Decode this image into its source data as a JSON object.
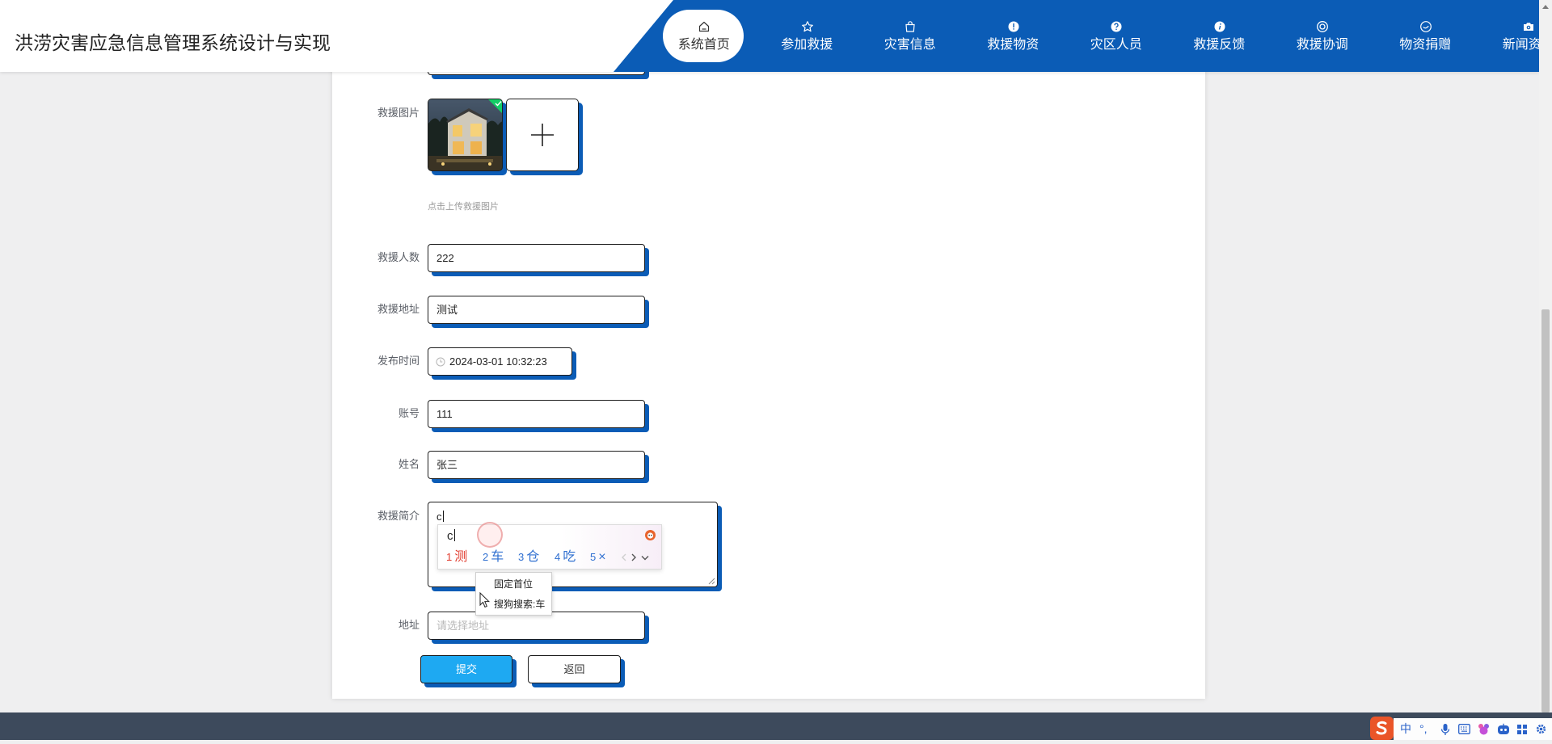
{
  "header": {
    "title": "洪涝灾害应急信息管理系统设计与实现"
  },
  "nav": {
    "items": [
      {
        "label": "系统首页",
        "icon": "home-icon",
        "active": true
      },
      {
        "label": "参加救援",
        "icon": "star-icon"
      },
      {
        "label": "灾害信息",
        "icon": "bag-icon"
      },
      {
        "label": "救援物资",
        "icon": "alert-circle-icon"
      },
      {
        "label": "灾区人员",
        "icon": "help-circle-icon"
      },
      {
        "label": "救援反馈",
        "icon": "info-circle-icon"
      },
      {
        "label": "救援协调",
        "icon": "lifebuoy-icon"
      },
      {
        "label": "物资捐赠",
        "icon": "smile-icon"
      },
      {
        "label": "新闻资讯",
        "icon": "camera-icon"
      }
    ]
  },
  "form": {
    "image": {
      "label": "救援图片",
      "hint": "点击上传救援图片"
    },
    "count": {
      "label": "救援人数",
      "value": "222"
    },
    "address": {
      "label": "救援地址",
      "value": "测试"
    },
    "time": {
      "label": "发布时间",
      "value": "2024-03-01 10:32:23"
    },
    "account": {
      "label": "账号",
      "value": "111"
    },
    "name": {
      "label": "姓名",
      "value": "张三"
    },
    "intro": {
      "label": "救援简介",
      "value": "c"
    },
    "location": {
      "label": "地址",
      "placeholder": "请选择地址"
    },
    "submit_label": "提交",
    "back_label": "返回"
  },
  "ime": {
    "composition": "c",
    "candidates": [
      {
        "num": "1",
        "text": "测"
      },
      {
        "num": "2",
        "text": "车"
      },
      {
        "num": "3",
        "text": "仓"
      },
      {
        "num": "4",
        "text": "吃"
      },
      {
        "num": "5",
        "text": "×"
      }
    ],
    "menu": [
      "固定首位",
      "搜狗搜索:车"
    ]
  },
  "tray": {
    "lang": "中",
    "punct": "°,"
  },
  "colors": {
    "brand_blue": "#0b5cb6",
    "submit_button": "#1ea9f2",
    "footer": "#3d4a5c",
    "first_candidate": "#e0392b",
    "candidate": "#2f6fd0"
  }
}
